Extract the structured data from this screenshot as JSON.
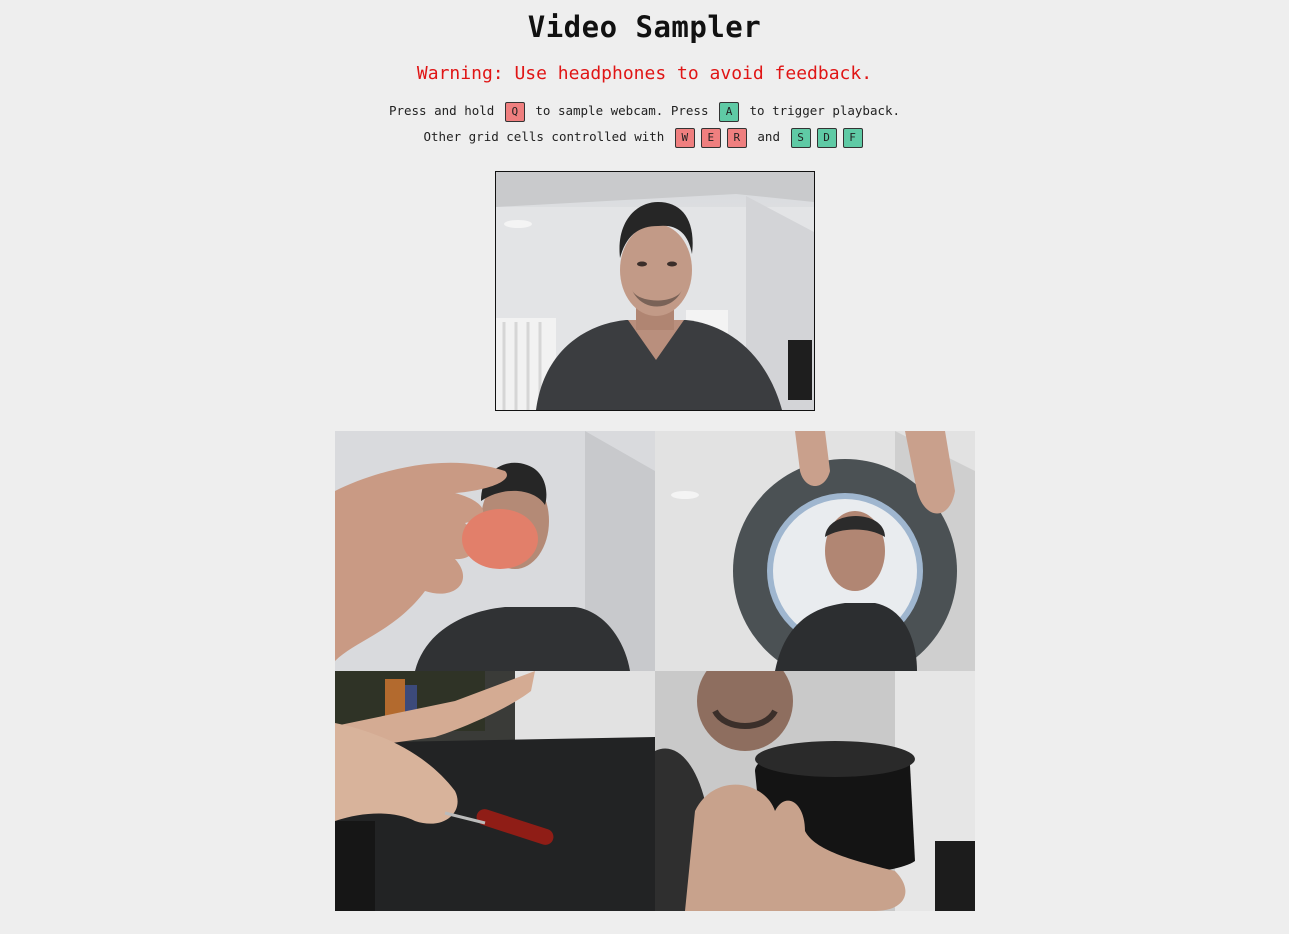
{
  "title": "Video Sampler",
  "warning": "Warning: Use headphones to avoid feedback.",
  "instructions": {
    "line1": {
      "part1": "Press and hold",
      "key_sample": "Q",
      "part2": "to sample webcam. Press",
      "key_play": "A",
      "part3": "to trigger playback."
    },
    "line2": {
      "part1": "Other grid cells controlled with",
      "sample_keys": [
        "W",
        "E",
        "R"
      ],
      "joiner": "and",
      "play_keys": [
        "S",
        "D",
        "F"
      ]
    }
  },
  "colors": {
    "background": "#eeeeee",
    "warning": "#e01515",
    "sample_key": "#ef7f7f",
    "play_key": "#5fcaa5"
  },
  "grid": {
    "rows": 2,
    "cols": 2,
    "cells": [
      {
        "sample_key": "Q",
        "play_key": "A"
      },
      {
        "sample_key": "W",
        "play_key": "S"
      },
      {
        "sample_key": "E",
        "play_key": "D"
      },
      {
        "sample_key": "R",
        "play_key": "F"
      }
    ]
  }
}
